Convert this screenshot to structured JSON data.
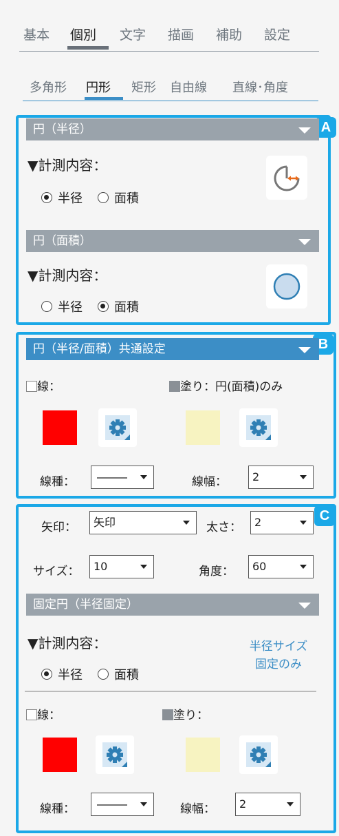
{
  "tabs": [
    "基本",
    "個別",
    "文字",
    "描画",
    "補助",
    "設定"
  ],
  "active_tab": "個別",
  "subtabs": [
    "多角形",
    "円形",
    "矩形",
    "自由線",
    "直線･角度"
  ],
  "active_subtab": "円形",
  "sectionA": {
    "badge": "A",
    "radius_panel": {
      "header": "円（半径）",
      "measure_title": "▼計測内容：",
      "options": [
        "半径",
        "面積"
      ],
      "selected": "半径"
    },
    "area_panel": {
      "header": "円（面積）",
      "measure_title": "▼計測内容：",
      "options": [
        "半径",
        "面積"
      ],
      "selected": "面積"
    }
  },
  "sectionB": {
    "badge": "B",
    "header": "円（半径/面積）共通設定",
    "line_label": "線：",
    "fill_label": "塗り：円(面積)のみ",
    "line_color": "#ff0000",
    "fill_color": "#f7f3c1",
    "line_type_label": "線種：",
    "line_width_label": "線幅：",
    "line_width_value": "2"
  },
  "sectionC": {
    "badge": "C",
    "arrow_label": "矢印：",
    "arrow_value": "矢印",
    "thickness_label": "太さ：",
    "thickness_value": "2",
    "size_label": "サイズ：",
    "size_value": "10",
    "angle_label": "角度：",
    "angle_value": "60",
    "fixed_panel": {
      "header": "固定円（半径固定）",
      "measure_title": "▼計測内容：",
      "options": [
        "半径",
        "面積"
      ],
      "selected": "半径",
      "note_line1": "半径サイズ",
      "note_line2": "固定のみ"
    },
    "line_label": "線：",
    "fill_label": "塗り：",
    "line_color": "#ff0000",
    "fill_color": "#f7f3c1",
    "line_type_label": "線種：",
    "line_width_label": "線幅：",
    "line_width_value": "2"
  },
  "colors": {
    "accent": "#1ba8e7",
    "header_gray": "#9aa3ab",
    "header_blue": "#3c8ec6",
    "gear_bg": "#2f7fb4",
    "circle_fill": "#c9dcee"
  },
  "icons": {
    "radius_tool": "circle-radius-icon",
    "area_tool": "circle-area-icon",
    "settings": "gear-icon",
    "dropdown": "chevron-down-icon"
  }
}
